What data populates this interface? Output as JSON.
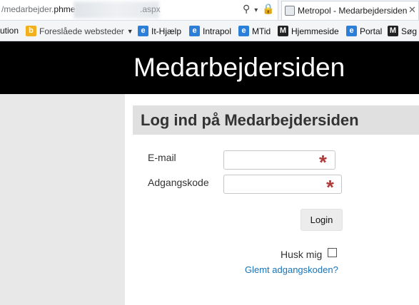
{
  "browser": {
    "url_prefix": "/medarbejder.",
    "url_host_visible": "phme",
    "url_suffix": ".aspx",
    "tab_title": "Metropol - Medarbejdersiden",
    "tab_close": "✕",
    "search_icon": "search-icon",
    "lock_icon": "lock-icon"
  },
  "favorites": {
    "partial": "ution",
    "suggested": "Foreslåede websteder",
    "items": [
      "It-Hjælp",
      "Intrapol",
      "MTid",
      "Hjemmeside",
      "Portal",
      "Søg"
    ]
  },
  "header": {
    "title": "Medarbejdersiden"
  },
  "login": {
    "title": "Log ind på Medarbejdersiden",
    "email_label": "E-mail",
    "email_value": "",
    "password_label": "Adgangskode",
    "password_value": "",
    "required_marker": "*",
    "login_button": "Login",
    "remember_label": "Husk mig",
    "remember_checked": false,
    "forgot_link": "Glemt adgangskoden?"
  },
  "colors": {
    "header_bg": "#000000",
    "required": "#b03a3a",
    "link": "#1a73b8"
  }
}
